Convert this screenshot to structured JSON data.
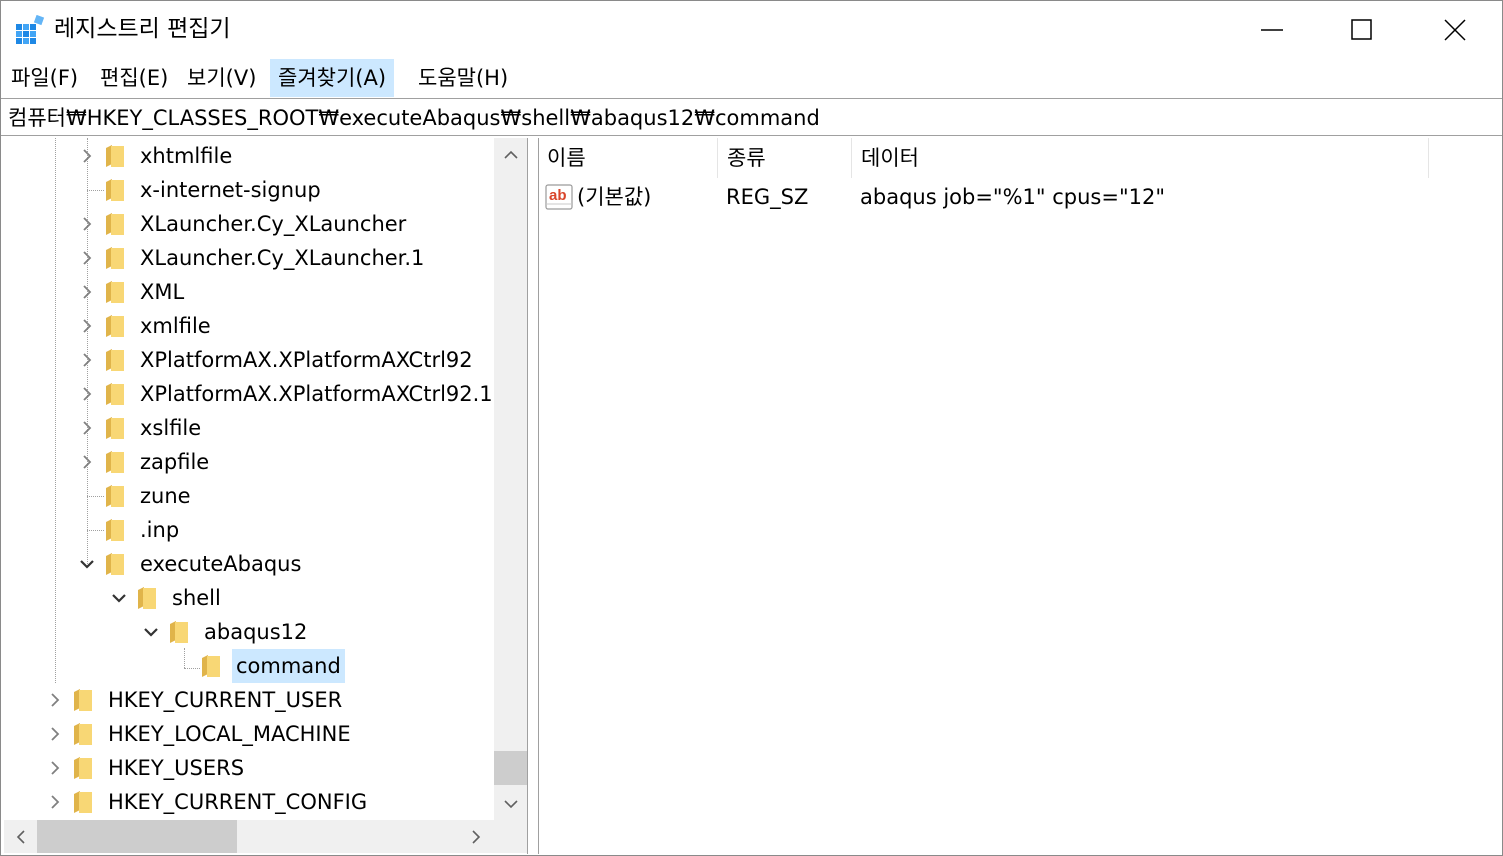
{
  "window": {
    "title": "레지스트리 편집기"
  },
  "menu": {
    "file": "파일(F)",
    "edit": "편집(E)",
    "view": "보기(V)",
    "favorites": "즐겨찾기(A)",
    "help": "도움말(H)"
  },
  "address": {
    "path": "컴퓨터₩HKEY_CLASSES_ROOT₩executeAbaqus₩shell₩abaqus12₩command"
  },
  "tree": {
    "items": [
      {
        "label": "xhtmlfile",
        "expander": "collapsed"
      },
      {
        "label": "x-internet-signup",
        "expander": "none"
      },
      {
        "label": "XLauncher.Cy_XLauncher",
        "expander": "collapsed"
      },
      {
        "label": "XLauncher.Cy_XLauncher.1",
        "expander": "collapsed"
      },
      {
        "label": "XML",
        "expander": "collapsed"
      },
      {
        "label": "xmlfile",
        "expander": "collapsed"
      },
      {
        "label": "XPlatformAX.XPlatformAXCtrl92",
        "expander": "collapsed"
      },
      {
        "label": "XPlatformAX.XPlatformAXCtrl92.1",
        "expander": "collapsed"
      },
      {
        "label": "xslfile",
        "expander": "collapsed"
      },
      {
        "label": "zapfile",
        "expander": "collapsed"
      },
      {
        "label": "zune",
        "expander": "none"
      },
      {
        "label": ".inp",
        "expander": "none"
      },
      {
        "label": "executeAbaqus",
        "expander": "expanded"
      },
      {
        "label": "shell",
        "expander": "expanded"
      },
      {
        "label": "abaqus12",
        "expander": "expanded"
      },
      {
        "label": "command",
        "expander": "none",
        "selected": true
      },
      {
        "label": "HKEY_CURRENT_USER",
        "expander": "collapsed"
      },
      {
        "label": "HKEY_LOCAL_MACHINE",
        "expander": "collapsed"
      },
      {
        "label": "HKEY_USERS",
        "expander": "collapsed"
      },
      {
        "label": "HKEY_CURRENT_CONFIG",
        "expander": "collapsed"
      }
    ]
  },
  "list": {
    "columns": {
      "name": "이름",
      "type": "종류",
      "data": "데이터"
    },
    "rows": [
      {
        "name": "(기본값)",
        "type": "REG_SZ",
        "data": "abaqus job=\"%1\" cpus=\"12\"",
        "icon": "string-value-icon"
      }
    ]
  },
  "icons": {
    "app": "registry-editor-icon",
    "folder": "folder-icon",
    "value": "ab-string-value-icon"
  },
  "colors": {
    "selection": "#cce8ff",
    "folder": "#f8d775",
    "folder_dark": "#e0b44a",
    "app_icon": "#1e88e5",
    "value_icon_red": "#d9452b"
  }
}
